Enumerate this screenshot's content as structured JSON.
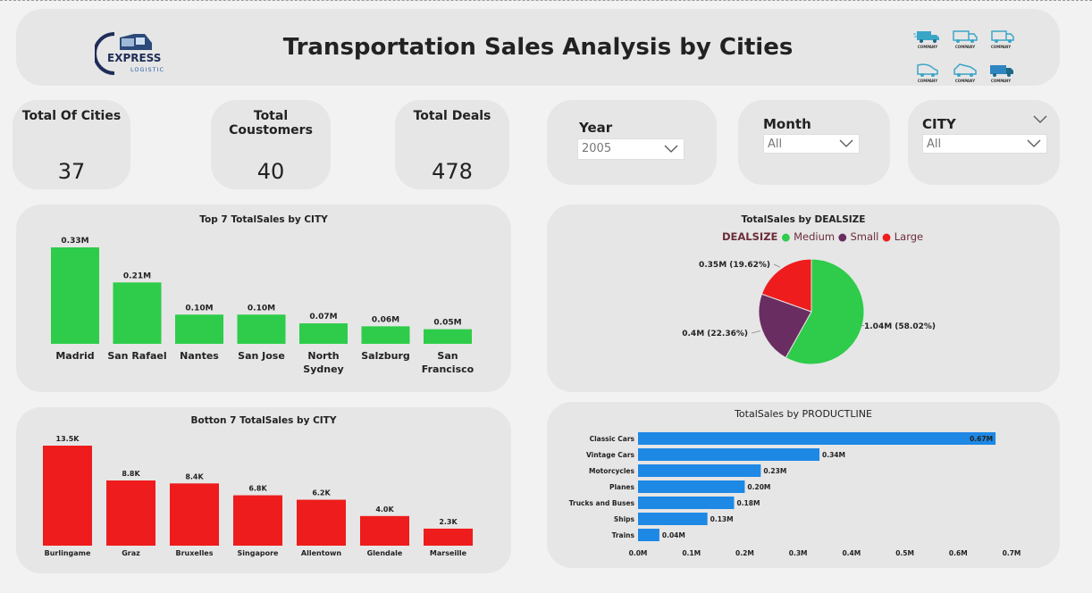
{
  "header": {
    "title": "Transportation Sales Analysis by Cities",
    "logo_line1": "EXPRESS",
    "logo_line2": "LOGISTIC",
    "company_label": "COMPANY"
  },
  "kpis": [
    {
      "label": "Total Of Cities",
      "value": "37"
    },
    {
      "label": "Total Coustomers",
      "value": "40"
    },
    {
      "label": "Total Deals",
      "value": "478"
    }
  ],
  "slicers": {
    "year": {
      "label": "Year",
      "value": "2005"
    },
    "month": {
      "label": "Month",
      "value": "All"
    },
    "city": {
      "label": "CITY",
      "value": "All"
    }
  },
  "colors": {
    "green": "#2ecc4a",
    "red": "#ee1c1c",
    "purple": "#6a2d62",
    "blue": "#1e88e5",
    "card": "#e6e6e6",
    "legend_title": "#6b2d3a"
  },
  "chart_data": [
    {
      "type": "bar",
      "title": "Top 7 TotalSales by CITY",
      "categories": [
        "Madrid",
        "San Rafael",
        "Nantes",
        "San Jose",
        "North Sydney",
        "Salzburg",
        "San Francisco"
      ],
      "category_lines": [
        [
          "Madrid"
        ],
        [
          "San Rafael"
        ],
        [
          "Nantes"
        ],
        [
          "San Jose"
        ],
        [
          "North",
          "Sydney"
        ],
        [
          "Salzburg"
        ],
        [
          "San",
          "Francisco"
        ]
      ],
      "values": [
        0.33,
        0.21,
        0.1,
        0.1,
        0.07,
        0.06,
        0.05
      ],
      "labels": [
        "0.33M",
        "0.21M",
        "0.10M",
        "0.10M",
        "0.07M",
        "0.06M",
        "0.05M"
      ],
      "color": "#2ecc4a"
    },
    {
      "type": "bar",
      "title": "Botton 7 TotalSales by CITY",
      "categories": [
        "Burlingame",
        "Graz",
        "Bruxelles",
        "Singapore",
        "Allentown",
        "Glendale",
        "Marseille"
      ],
      "values": [
        13.5,
        8.8,
        8.4,
        6.8,
        6.2,
        4.0,
        2.3
      ],
      "labels": [
        "13.5K",
        "8.8K",
        "8.4K",
        "6.8K",
        "6.2K",
        "4.0K",
        "2.3K"
      ],
      "color": "#ee1c1c"
    },
    {
      "type": "pie",
      "title": "TotalSales by DEALSIZE",
      "legend_title": "DEALSIZE",
      "slices": [
        {
          "name": "Medium",
          "value": 1.04,
          "percent": 58.02,
          "label": "1.04M (58.02%)",
          "color": "#2ecc4a"
        },
        {
          "name": "Small",
          "value": 0.4,
          "percent": 22.36,
          "label": "0.4M (22.36%)",
          "color": "#6a2d62"
        },
        {
          "name": "Large",
          "value": 0.35,
          "percent": 19.62,
          "label": "0.35M (19.62%)",
          "color": "#ee1c1c"
        }
      ]
    },
    {
      "type": "bar",
      "orientation": "horizontal",
      "title": "TotalSales by PRODUCTLINE",
      "categories": [
        "Classic Cars",
        "Vintage Cars",
        "Motorcycles",
        "Planes",
        "Trucks and Buses",
        "Ships",
        "Trains"
      ],
      "values": [
        0.67,
        0.34,
        0.23,
        0.2,
        0.18,
        0.13,
        0.04
      ],
      "labels": [
        "0.67M",
        "0.34M",
        "0.23M",
        "0.20M",
        "0.18M",
        "0.13M",
        "0.04M"
      ],
      "xlim": [
        0,
        0.7
      ],
      "xticks": [
        "0.0M",
        "0.1M",
        "0.2M",
        "0.3M",
        "0.4M",
        "0.5M",
        "0.6M",
        "0.7M"
      ],
      "color": "#1e88e5"
    }
  ]
}
